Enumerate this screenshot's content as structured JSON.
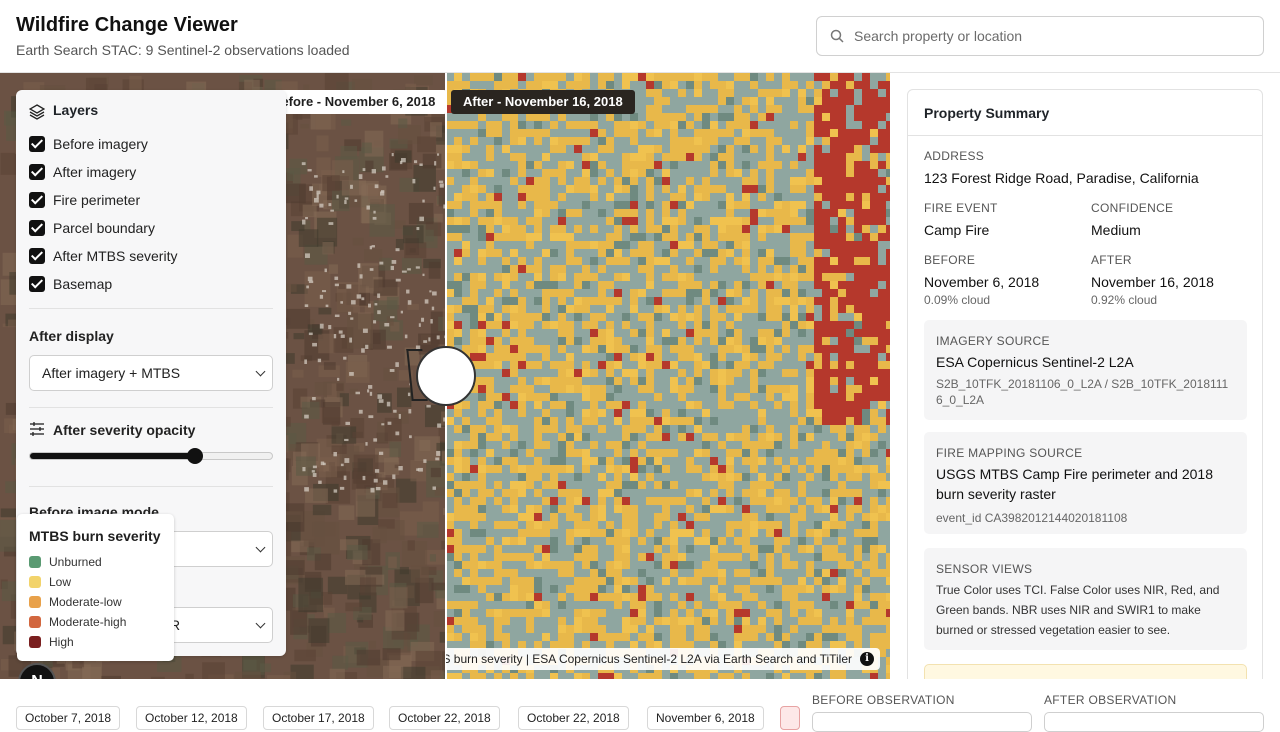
{
  "header": {
    "title": "Wildfire Change Viewer",
    "subtitle": "Earth Search STAC: 9 Sentinel-2 observations loaded",
    "search_placeholder": "Search property or location"
  },
  "map": {
    "before_tag": "Before - November 6, 2018",
    "after_tag": "After - November 16, 2018",
    "attribution": "S burn severity | ESA Copernicus Sentinel-2 L2A via Earth Search and TiTiler",
    "info_glyph": "i",
    "colors": {
      "before_base": "#6b5244",
      "after_base": "#e8b84a",
      "after_gray": "#8fa6a0",
      "after_red": "#b5382c",
      "divider": "#ffffff"
    }
  },
  "layers": {
    "title": "Layers",
    "items": [
      {
        "label": "Before imagery",
        "checked": true
      },
      {
        "label": "After imagery",
        "checked": true
      },
      {
        "label": "Fire perimeter",
        "checked": true
      },
      {
        "label": "Parcel boundary",
        "checked": true
      },
      {
        "label": "After MTBS severity",
        "checked": true
      },
      {
        "label": "Basemap",
        "checked": true
      }
    ],
    "after_display_label": "After display",
    "after_display_value": "After imagery + MTBS",
    "opacity_label": "After severity opacity",
    "opacity_value": 0.68,
    "before_mode_label": "Before image mode",
    "hidden_select_fragment": "R"
  },
  "legend": {
    "title": "MTBS burn severity",
    "items": [
      {
        "label": "Unburned",
        "color": "#5a9a72"
      },
      {
        "label": "Low",
        "color": "#f2d36b"
      },
      {
        "label": "Moderate-low",
        "color": "#e8a14a"
      },
      {
        "label": "Moderate-high",
        "color": "#d2673f"
      },
      {
        "label": "High",
        "color": "#7a1f1f"
      }
    ]
  },
  "avatar_initial": "N",
  "summary": {
    "title": "Property Summary",
    "address_label": "ADDRESS",
    "address": "123 Forest Ridge Road, Paradise, California",
    "fire_event_label": "FIRE EVENT",
    "fire_event": "Camp Fire",
    "confidence_label": "CONFIDENCE",
    "confidence": "Medium",
    "before_label": "BEFORE",
    "before_date": "November 6, 2018",
    "before_cloud": "0.09% cloud",
    "after_label": "AFTER",
    "after_date": "November 16, 2018",
    "after_cloud": "0.92% cloud",
    "imagery_label": "IMAGERY SOURCE",
    "imagery_source": "ESA Copernicus Sentinel-2 L2A",
    "imagery_ids_line1": "S2B_10TFK_20181106_0_L2A / S2B_10TFK_2018111",
    "imagery_ids_line2": "6_0_L2A",
    "fire_mapping_label": "FIRE MAPPING SOURCE",
    "fire_mapping_line1": "USGS MTBS Camp Fire perimeter and 2018",
    "fire_mapping_line2": "burn severity raster",
    "event_id": "event_id CA3982012144020181108",
    "sensor_label": "SENSOR VIEWS",
    "sensor_line1": "True Color uses TCI. False Color uses NIR, Red, and",
    "sensor_line2": "Green bands. NBR uses NIR and SWIR1 to make",
    "sensor_line3": "burned or stressed vegetation easier to see."
  },
  "timeline": {
    "dates": [
      "October 7, 2018",
      "October 12, 2018",
      "October 17, 2018",
      "October 22, 2018",
      "October 22, 2018",
      "November 6, 2018"
    ],
    "before_observation_label": "BEFORE OBSERVATION",
    "after_observation_label": "AFTER OBSERVATION"
  }
}
